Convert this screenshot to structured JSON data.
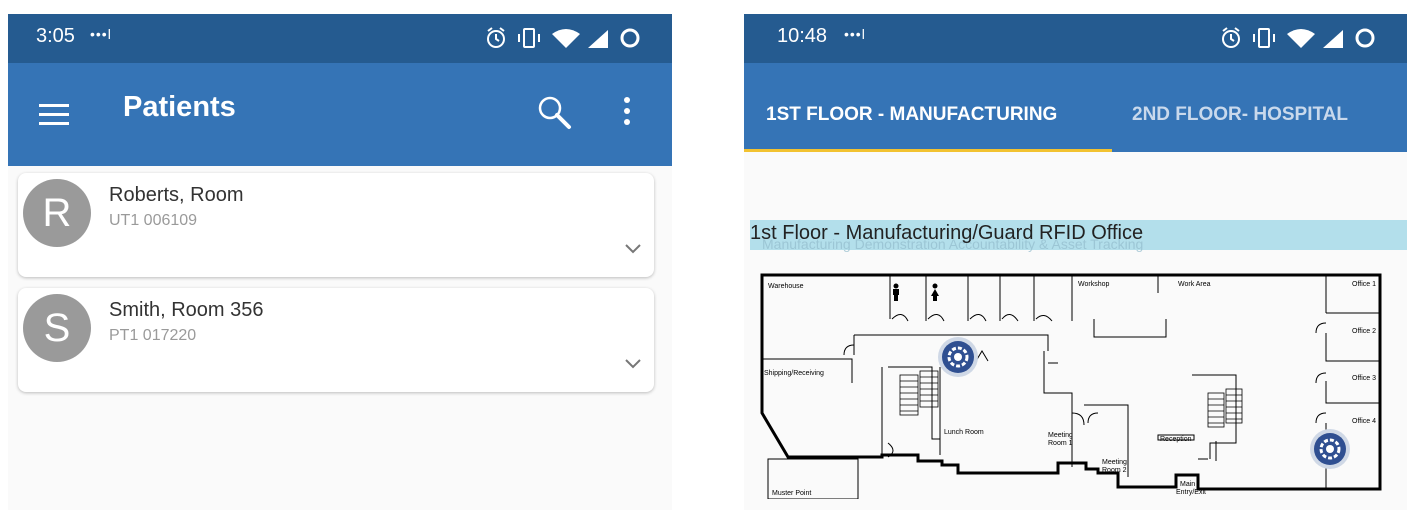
{
  "left_screen": {
    "status": {
      "time": "3:05",
      "dots": "•••l"
    },
    "appbar": {
      "title": "Patients"
    },
    "patients": [
      {
        "initial": "R",
        "name": "Roberts, Room",
        "id": "UT1 006109"
      },
      {
        "initial": "S",
        "name": "Smith, Room 356",
        "id": "PT1 017220"
      }
    ]
  },
  "right_screen": {
    "status": {
      "time": "10:48",
      "dots": "•••l"
    },
    "tabs": [
      {
        "label": "1ST FLOOR - MANUFACTURING",
        "selected": true
      },
      {
        "label": "2ND FLOOR- HOSPITAL",
        "selected": false
      }
    ],
    "map_title": "1st Floor - Manufacturing/Guard RFID Office",
    "map_title_ghost": "Manufacturing Demonstration Accountability & Asset Tracking",
    "rooms": {
      "warehouse": "Warehouse",
      "workshop": "Workshop",
      "work_area": "Work Area",
      "office1": "Office 1",
      "office2": "Office 2",
      "office3": "Office 3",
      "office4": "Office 4",
      "shipping": "Shipping/Receiving",
      "lunch": "Lunch Room",
      "meeting1_a": "Meeting",
      "meeting1_b": "Room 1",
      "meeting2_a": "Meeting",
      "meeting2_b": "Room 2",
      "reception": "Reception",
      "main_a": "Main",
      "main_b": "Entry/Exit",
      "muster": "Muster Point"
    }
  },
  "colors": {
    "status_bar": "#255b90",
    "app_bar": "#3574b6",
    "tab_indicator": "#f2c230",
    "map_title_bg": "#b3dfeb",
    "avatar": "#9a9a9a"
  }
}
